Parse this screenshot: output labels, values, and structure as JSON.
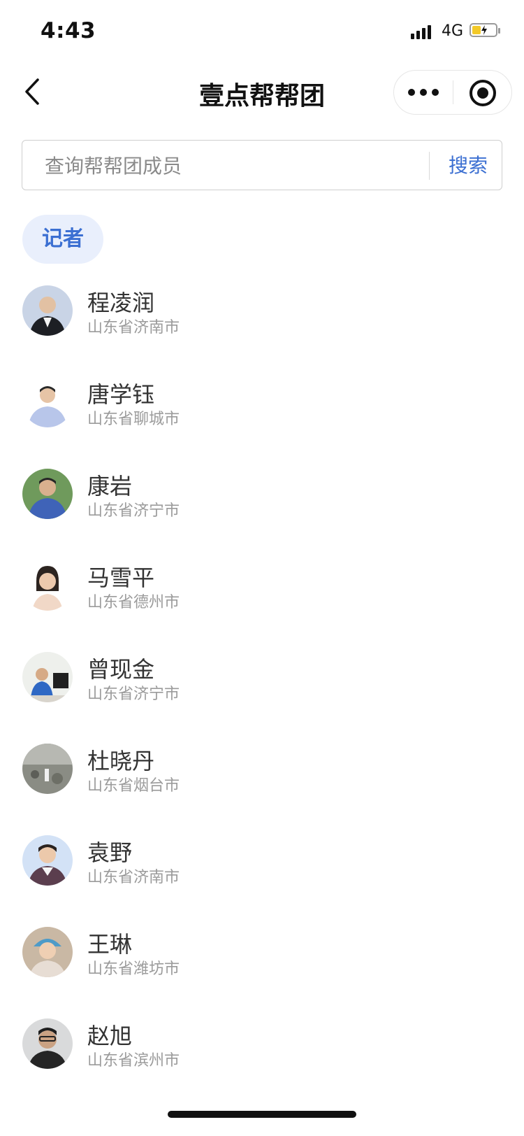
{
  "status_bar": {
    "time": "4:43",
    "network": "4G",
    "icons": [
      "signal-icon",
      "battery-charging-icon"
    ],
    "battery_fill_color": "#f3c928"
  },
  "nav": {
    "title": "壹点帮帮团",
    "icons": [
      "back-chevron-icon",
      "more-dots-icon",
      "target-icon"
    ]
  },
  "search": {
    "placeholder": "查询帮帮团成员",
    "button_label": "搜索",
    "accent_color": "#3b6fd2"
  },
  "category": {
    "label": "记者",
    "chip_bg": "#e9effc"
  },
  "members": [
    {
      "name": "程凌润",
      "city": "山东省济南市"
    },
    {
      "name": "唐学钰",
      "city": "山东省聊城市"
    },
    {
      "name": "康岩",
      "city": "山东省济宁市"
    },
    {
      "name": "马雪平",
      "city": "山东省德州市"
    },
    {
      "name": "曾现金",
      "city": "山东省济宁市"
    },
    {
      "name": "杜晓丹",
      "city": "山东省烟台市"
    },
    {
      "name": "袁野",
      "city": "山东省济南市"
    },
    {
      "name": "王琳",
      "city": "山东省潍坊市"
    },
    {
      "name": "赵旭",
      "city": "山东省滨州市"
    }
  ]
}
